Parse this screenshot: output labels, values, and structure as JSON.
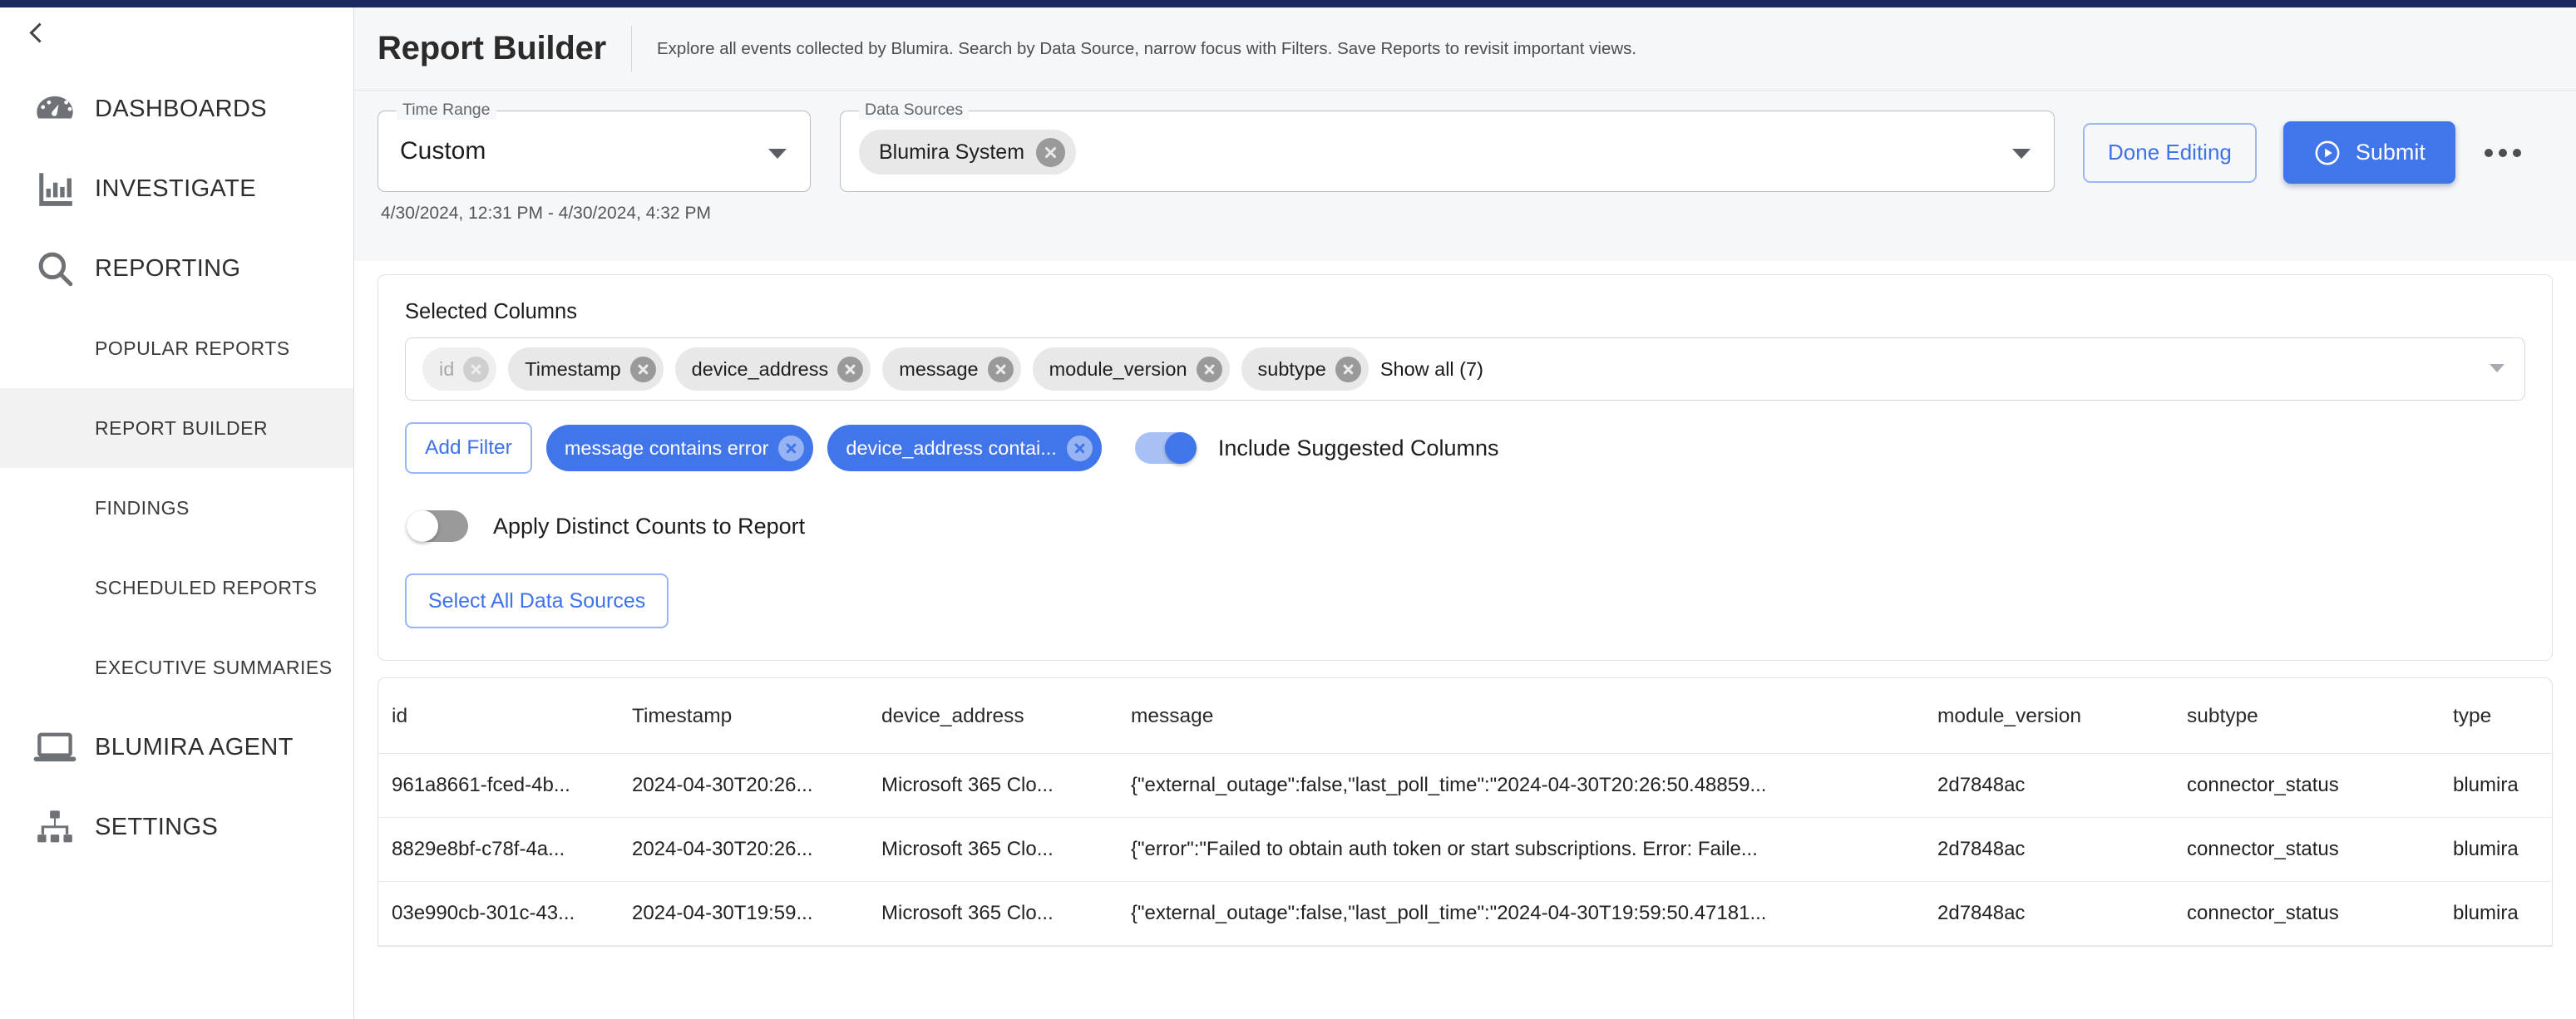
{
  "sidebar": {
    "collapse_icon": "chevron-left-icon",
    "items": [
      {
        "label": "DASHBOARDS",
        "icon": "gauge-icon",
        "type": "top",
        "active": false
      },
      {
        "label": "INVESTIGATE",
        "icon": "bar-chart-icon",
        "type": "top",
        "active": false
      },
      {
        "label": "REPORTING",
        "icon": "search-icon",
        "type": "top",
        "active": false
      },
      {
        "label": "POPULAR REPORTS",
        "icon": "",
        "type": "sub",
        "active": false
      },
      {
        "label": "REPORT BUILDER",
        "icon": "",
        "type": "sub",
        "active": true
      },
      {
        "label": "FINDINGS",
        "icon": "",
        "type": "sub",
        "active": false
      },
      {
        "label": "SCHEDULED REPORTS",
        "icon": "",
        "type": "sub",
        "active": false
      },
      {
        "label": "EXECUTIVE SUMMARIES",
        "icon": "",
        "type": "sub",
        "active": false
      },
      {
        "label": "BLUMIRA AGENT",
        "icon": "laptop-icon",
        "type": "top",
        "active": false
      },
      {
        "label": "SETTINGS",
        "icon": "sitemap-icon",
        "type": "top",
        "active": false
      }
    ]
  },
  "header": {
    "title": "Report Builder",
    "description": "Explore all events collected by Blumira. Search by Data Source, narrow focus with Filters. Save Reports to revisit important views."
  },
  "controls": {
    "time_range": {
      "legend": "Time Range",
      "value": "Custom",
      "range_text": "4/30/2024, 12:31 PM - 4/30/2024, 4:32 PM"
    },
    "data_sources": {
      "legend": "Data Sources",
      "chips": [
        "Blumira System"
      ]
    },
    "done_editing_label": "Done Editing",
    "submit_label": "Submit",
    "more_menu_icon": "ellipsis-icon"
  },
  "builder": {
    "selected_columns_title": "Selected Columns",
    "column_chips": [
      {
        "label": "id",
        "disabled": true
      },
      {
        "label": "Timestamp",
        "disabled": false
      },
      {
        "label": "device_address",
        "disabled": false
      },
      {
        "label": "message",
        "disabled": false
      },
      {
        "label": "module_version",
        "disabled": false
      },
      {
        "label": "subtype",
        "disabled": false
      }
    ],
    "show_all_label": "Show all (7)",
    "add_filter_label": "Add Filter",
    "filter_chips": [
      "message contains error",
      "device_address contai..."
    ],
    "include_suggested_columns": {
      "label": "Include Suggested Columns",
      "state": "on"
    },
    "apply_distinct_counts": {
      "label": "Apply Distinct Counts to Report",
      "state": "off"
    },
    "select_all_data_sources_label": "Select All Data Sources"
  },
  "table": {
    "columns": [
      "id",
      "Timestamp",
      "device_address",
      "message",
      "module_version",
      "subtype",
      "type"
    ],
    "rows": [
      {
        "id": "961a8661-fced-4b...",
        "Timestamp": "2024-04-30T20:26...",
        "device_address": "Microsoft 365 Clo...",
        "message": "{\"external_outage\":false,\"last_poll_time\":\"2024-04-30T20:26:50.48859...",
        "module_version": "2d7848ac",
        "subtype": "connector_status",
        "type": "blumira"
      },
      {
        "id": "8829e8bf-c78f-4a...",
        "Timestamp": "2024-04-30T20:26...",
        "device_address": "Microsoft 365 Clo...",
        "message": "{\"error\":\"Failed to obtain auth token or start subscriptions. Error: Faile...",
        "module_version": "2d7848ac",
        "subtype": "connector_status",
        "type": "blumira"
      },
      {
        "id": "03e990cb-301c-43...",
        "Timestamp": "2024-04-30T19:59...",
        "device_address": "Microsoft 365 Clo...",
        "message": "{\"external_outage\":false,\"last_poll_time\":\"2024-04-30T19:59:50.47181...",
        "module_version": "2d7848ac",
        "subtype": "connector_status",
        "type": "blumira"
      }
    ]
  },
  "colors": {
    "accent_blue": "#4175ea",
    "accent_blue_light": "#9ab6f7",
    "topbar_navy": "#1b2a5e",
    "chip_grey": "#e8e8e8",
    "page_bg": "#f6f7f9"
  }
}
